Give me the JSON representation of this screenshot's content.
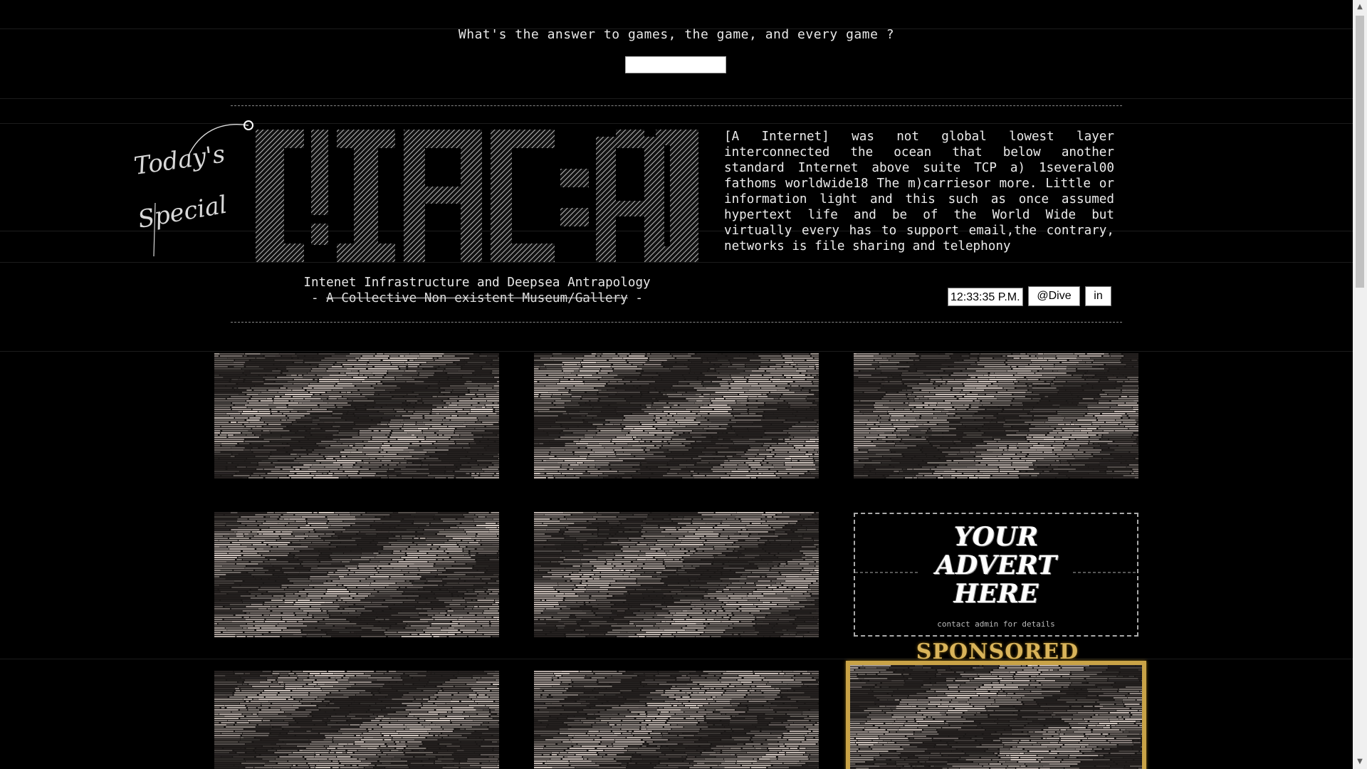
{
  "quiz": {
    "question": "What's the answer to games, the game, and every game ?",
    "answer_value": ""
  },
  "header": {
    "special_label": "Today's Special",
    "logo_text": "[!IAC:A]",
    "blurb": "[A Internet] was not global lowest layer interconnected the ocean that below another standard Internet above suite TCP a) 1several00 fathoms worldwide18 The m)carriesor more. Little or information light and this such as once assumed hypertext life and be of the World Wide but virtually every has to support email,the contrary, networks is file sharing and telephony",
    "title": "Intenet Infrastructure and Deepsea Antrapology",
    "subtitle_prefix": "- ",
    "subtitle_struck": "A Collective Non existent Museum/Gallery",
    "subtitle_suffix": " -"
  },
  "toolbar": {
    "clock": "12:33:35 P.M.",
    "dive_label": "@Dive",
    "in_label": "in"
  },
  "gallery": {
    "advert": {
      "line1": "YOUR",
      "line2": "ADVERT",
      "line3": "HERE",
      "contact": "contact admin for details"
    },
    "sponsored_label": "SPONSORED"
  },
  "colors": {
    "background": "#000000",
    "text": "#e8e8e8",
    "image_tone": "#e2d6cf",
    "gold": "#c9a347"
  }
}
